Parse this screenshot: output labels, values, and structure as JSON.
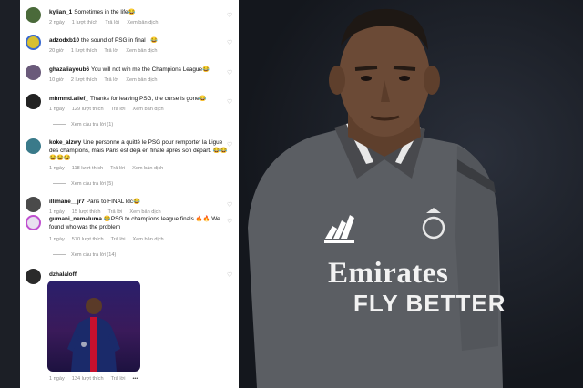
{
  "comments": [
    {
      "username": "kylian_1",
      "text": "Sometimes in the life😂",
      "time": "2 ngày",
      "likes": "1 lượt thích",
      "reply": "Trả lời",
      "translate": "Xem bản dịch"
    },
    {
      "username": "adzodxb10",
      "text": "the sound of PSG in final ! 😂",
      "time": "20 giờ",
      "likes": "1 lượt thích",
      "reply": "Trả lời",
      "translate": "Xem bản dịch"
    },
    {
      "username": "ghazaliayoub6",
      "text": "You will not win me the Champions League😂",
      "time": "10 giờ",
      "likes": "2 lượt thích",
      "reply": "Trả lời",
      "translate": "Xem bản dịch"
    },
    {
      "username": "mhmmd.alief_",
      "text": "Thanks for leaving PSG, the curse is gone😂",
      "time": "1 ngày",
      "likes": "129 lượt thích",
      "reply": "Trả lời",
      "translate": "Xem bản dịch",
      "view_replies": "Xem câu trả lời (1)"
    },
    {
      "username": "koke_alzwy",
      "text": "Une personne a quitté le PSG pour remporter la Ligue des champions, mais Paris est déjà en finale après son départ. 😂😂😂😂😂",
      "time": "1 ngày",
      "likes": "118 lượt thích",
      "reply": "Trả lời",
      "translate": "Xem bản dịch",
      "view_replies": "Xem câu trả lời (5)"
    },
    {
      "username": "illimane__jr7",
      "text": "Paris to FINAL ldc😂",
      "time": "1 ngày",
      "likes": "15 lượt thích",
      "reply": "Trả lời",
      "translate": "Xem bản dịch"
    },
    {
      "username": "gumani_nemaluma",
      "text": "😂PSG to champions league finals 🔥🔥 We found who was the problem",
      "time": "1 ngày",
      "likes": "570 lượt thích",
      "reply": "Trả lời",
      "translate": "Xem bản dịch",
      "view_replies": "Xem câu trả lời (14)"
    },
    {
      "username": "dzhalaloff",
      "text": "",
      "time": "1 ngày",
      "likes": "134 lượt thích",
      "reply": "Trả lời",
      "more": "•••"
    }
  ],
  "photo": {
    "sponsor_line1": "Emirates",
    "sponsor_line2": "FLY BETTER"
  },
  "colors": {
    "jersey": "#5a5d62",
    "skin": "#6b4a36",
    "text_meta": "#8a8a8a"
  }
}
